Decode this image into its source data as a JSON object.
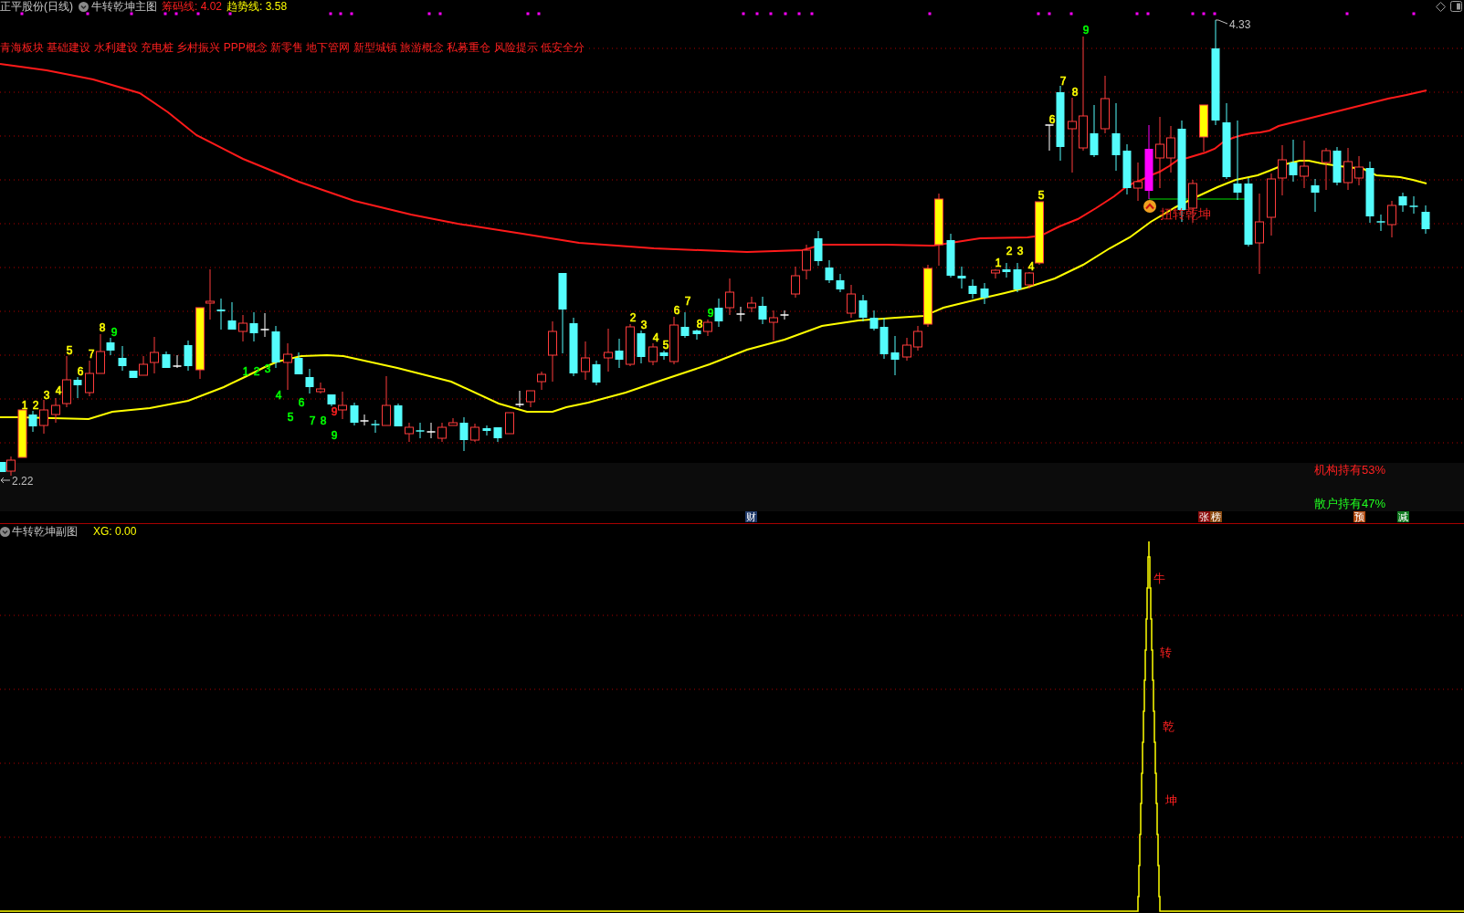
{
  "header": {
    "title": "正平股份(日线)",
    "indicator": "牛转乾坤主图",
    "readings": [
      {
        "label": "筹码线: 4.02",
        "color": "#ff2020"
      },
      {
        "label": "趋势线: 3.58",
        "color": "#ffff00"
      }
    ]
  },
  "concepts": "青海板块 基础建设 水利建设 充电桩 乡村振兴 PPP概念 新零售 地下管网 新型城镇 旅游概念 私募重仓 风险提示 低安全分",
  "chart": {
    "high_marker": "4.33",
    "low_marker": "2.22",
    "signal_label": "扭转乾坤",
    "count_labels": [
      {
        "text": "1",
        "color": "#ffff00"
      },
      {
        "text": "2",
        "color": "#ffff00"
      },
      {
        "text": "3",
        "color": "#ffff00"
      },
      {
        "text": "4",
        "color": "#ffff00"
      },
      {
        "text": "5",
        "color": "#ffff00"
      },
      {
        "text": "6",
        "color": "#ffff00"
      },
      {
        "text": "7",
        "color": "#ffff00"
      },
      {
        "text": "8",
        "color": "#ffff00"
      },
      {
        "text": "9",
        "color": "#00ff00"
      },
      {
        "text": "1",
        "color": "#00ff00"
      },
      {
        "text": "2",
        "color": "#00ff00"
      },
      {
        "text": "3",
        "color": "#00ff00"
      },
      {
        "text": "4",
        "color": "#00ff00"
      },
      {
        "text": "5",
        "color": "#00ff00"
      },
      {
        "text": "6",
        "color": "#00ff00"
      },
      {
        "text": "7",
        "color": "#00ff00"
      },
      {
        "text": "8",
        "color": "#00ff00"
      },
      {
        "text": "9",
        "color": "#ff2020"
      },
      {
        "text": "9",
        "color": "#00ff00"
      },
      {
        "text": "2",
        "color": "#ffff00"
      },
      {
        "text": "3",
        "color": "#ffff00"
      },
      {
        "text": "4",
        "color": "#ffff00"
      },
      {
        "text": "5",
        "color": "#ffff00"
      },
      {
        "text": "6",
        "color": "#ffff00"
      },
      {
        "text": "7",
        "color": "#ffff00"
      },
      {
        "text": "8",
        "color": "#ffff00"
      },
      {
        "text": "9",
        "color": "#00ff00"
      },
      {
        "text": "1",
        "color": "#ffff00"
      },
      {
        "text": "2",
        "color": "#ffff00"
      },
      {
        "text": "3",
        "color": "#ffff00"
      },
      {
        "text": "4",
        "color": "#ffff00"
      },
      {
        "text": "5",
        "color": "#ffff00"
      },
      {
        "text": "6",
        "color": "#ffff00"
      },
      {
        "text": "7",
        "color": "#ffff00"
      },
      {
        "text": "8",
        "color": "#ffff00"
      },
      {
        "text": "9",
        "color": "#00ff00"
      }
    ]
  },
  "holdings": [
    {
      "text": "机构持有53%",
      "color": "#ff2020"
    },
    {
      "text": "散户持有47%",
      "color": "#20ff20"
    }
  ],
  "badges": [
    {
      "text": "财",
      "color": "#203a6a"
    },
    {
      "text": "张",
      "color": "#8a0a0a"
    },
    {
      "text": "榜",
      "color": "#8a4a10"
    },
    {
      "text": "预",
      "color": "#b04a10"
    },
    {
      "text": "减",
      "color": "#107a20"
    }
  ],
  "sub_panel": {
    "title": "牛转乾坤副图",
    "reading": "XG: 0.00",
    "peak_labels": [
      "牛",
      "转",
      "乾",
      "坤"
    ]
  }
}
